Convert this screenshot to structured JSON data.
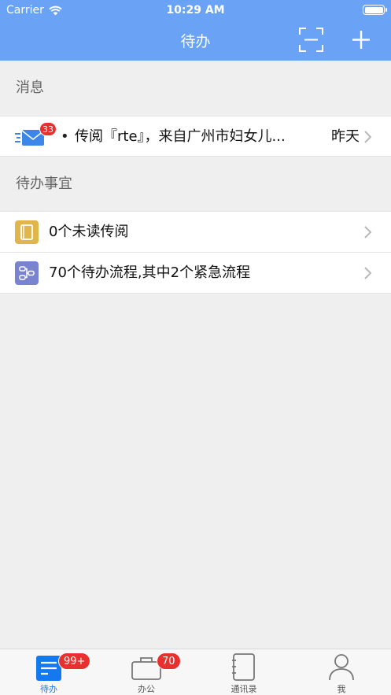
{
  "status_bar": {
    "carrier": "Carrier",
    "time": "10:29 AM"
  },
  "nav": {
    "title": "待办"
  },
  "messages": {
    "header": "消息",
    "item": {
      "bullet": "•",
      "text": "传阅『rte』，来自广州市妇女儿...",
      "date": "昨天",
      "badge": "33"
    }
  },
  "todo": {
    "header": "待办事宜",
    "items": [
      {
        "label": "0个未读传阅",
        "icon": "book-icon"
      },
      {
        "label": "70个待办流程,其中2个紧急流程",
        "icon": "flow-icon"
      }
    ]
  },
  "tabs": [
    {
      "label": "待办",
      "badge": "99+",
      "icon": "todo-list-icon",
      "active": true
    },
    {
      "label": "办公",
      "badge": "70",
      "icon": "briefcase-icon",
      "active": false
    },
    {
      "label": "通讯录",
      "icon": "contacts-book-icon",
      "active": false
    },
    {
      "label": "我",
      "icon": "person-icon",
      "active": false
    }
  ],
  "colors": {
    "brand": "#6aa3f5",
    "active_tab": "#1478f0",
    "badge": "#e8302e"
  }
}
